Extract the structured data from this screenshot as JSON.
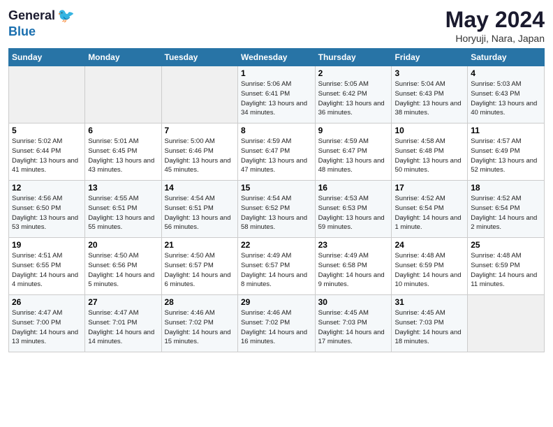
{
  "header": {
    "logo_general": "General",
    "logo_blue": "Blue",
    "month": "May 2024",
    "location": "Horyuji, Nara, Japan"
  },
  "weekdays": [
    "Sunday",
    "Monday",
    "Tuesday",
    "Wednesday",
    "Thursday",
    "Friday",
    "Saturday"
  ],
  "weeks": [
    [
      {
        "day": "",
        "info": ""
      },
      {
        "day": "",
        "info": ""
      },
      {
        "day": "",
        "info": ""
      },
      {
        "day": "1",
        "info": "Sunrise: 5:06 AM\nSunset: 6:41 PM\nDaylight: 13 hours\nand 34 minutes."
      },
      {
        "day": "2",
        "info": "Sunrise: 5:05 AM\nSunset: 6:42 PM\nDaylight: 13 hours\nand 36 minutes."
      },
      {
        "day": "3",
        "info": "Sunrise: 5:04 AM\nSunset: 6:43 PM\nDaylight: 13 hours\nand 38 minutes."
      },
      {
        "day": "4",
        "info": "Sunrise: 5:03 AM\nSunset: 6:43 PM\nDaylight: 13 hours\nand 40 minutes."
      }
    ],
    [
      {
        "day": "5",
        "info": "Sunrise: 5:02 AM\nSunset: 6:44 PM\nDaylight: 13 hours\nand 41 minutes."
      },
      {
        "day": "6",
        "info": "Sunrise: 5:01 AM\nSunset: 6:45 PM\nDaylight: 13 hours\nand 43 minutes."
      },
      {
        "day": "7",
        "info": "Sunrise: 5:00 AM\nSunset: 6:46 PM\nDaylight: 13 hours\nand 45 minutes."
      },
      {
        "day": "8",
        "info": "Sunrise: 4:59 AM\nSunset: 6:47 PM\nDaylight: 13 hours\nand 47 minutes."
      },
      {
        "day": "9",
        "info": "Sunrise: 4:59 AM\nSunset: 6:47 PM\nDaylight: 13 hours\nand 48 minutes."
      },
      {
        "day": "10",
        "info": "Sunrise: 4:58 AM\nSunset: 6:48 PM\nDaylight: 13 hours\nand 50 minutes."
      },
      {
        "day": "11",
        "info": "Sunrise: 4:57 AM\nSunset: 6:49 PM\nDaylight: 13 hours\nand 52 minutes."
      }
    ],
    [
      {
        "day": "12",
        "info": "Sunrise: 4:56 AM\nSunset: 6:50 PM\nDaylight: 13 hours\nand 53 minutes."
      },
      {
        "day": "13",
        "info": "Sunrise: 4:55 AM\nSunset: 6:51 PM\nDaylight: 13 hours\nand 55 minutes."
      },
      {
        "day": "14",
        "info": "Sunrise: 4:54 AM\nSunset: 6:51 PM\nDaylight: 13 hours\nand 56 minutes."
      },
      {
        "day": "15",
        "info": "Sunrise: 4:54 AM\nSunset: 6:52 PM\nDaylight: 13 hours\nand 58 minutes."
      },
      {
        "day": "16",
        "info": "Sunrise: 4:53 AM\nSunset: 6:53 PM\nDaylight: 13 hours\nand 59 minutes."
      },
      {
        "day": "17",
        "info": "Sunrise: 4:52 AM\nSunset: 6:54 PM\nDaylight: 14 hours\nand 1 minute."
      },
      {
        "day": "18",
        "info": "Sunrise: 4:52 AM\nSunset: 6:54 PM\nDaylight: 14 hours\nand 2 minutes."
      }
    ],
    [
      {
        "day": "19",
        "info": "Sunrise: 4:51 AM\nSunset: 6:55 PM\nDaylight: 14 hours\nand 4 minutes."
      },
      {
        "day": "20",
        "info": "Sunrise: 4:50 AM\nSunset: 6:56 PM\nDaylight: 14 hours\nand 5 minutes."
      },
      {
        "day": "21",
        "info": "Sunrise: 4:50 AM\nSunset: 6:57 PM\nDaylight: 14 hours\nand 6 minutes."
      },
      {
        "day": "22",
        "info": "Sunrise: 4:49 AM\nSunset: 6:57 PM\nDaylight: 14 hours\nand 8 minutes."
      },
      {
        "day": "23",
        "info": "Sunrise: 4:49 AM\nSunset: 6:58 PM\nDaylight: 14 hours\nand 9 minutes."
      },
      {
        "day": "24",
        "info": "Sunrise: 4:48 AM\nSunset: 6:59 PM\nDaylight: 14 hours\nand 10 minutes."
      },
      {
        "day": "25",
        "info": "Sunrise: 4:48 AM\nSunset: 6:59 PM\nDaylight: 14 hours\nand 11 minutes."
      }
    ],
    [
      {
        "day": "26",
        "info": "Sunrise: 4:47 AM\nSunset: 7:00 PM\nDaylight: 14 hours\nand 13 minutes."
      },
      {
        "day": "27",
        "info": "Sunrise: 4:47 AM\nSunset: 7:01 PM\nDaylight: 14 hours\nand 14 minutes."
      },
      {
        "day": "28",
        "info": "Sunrise: 4:46 AM\nSunset: 7:02 PM\nDaylight: 14 hours\nand 15 minutes."
      },
      {
        "day": "29",
        "info": "Sunrise: 4:46 AM\nSunset: 7:02 PM\nDaylight: 14 hours\nand 16 minutes."
      },
      {
        "day": "30",
        "info": "Sunrise: 4:45 AM\nSunset: 7:03 PM\nDaylight: 14 hours\nand 17 minutes."
      },
      {
        "day": "31",
        "info": "Sunrise: 4:45 AM\nSunset: 7:03 PM\nDaylight: 14 hours\nand 18 minutes."
      },
      {
        "day": "",
        "info": ""
      }
    ]
  ]
}
